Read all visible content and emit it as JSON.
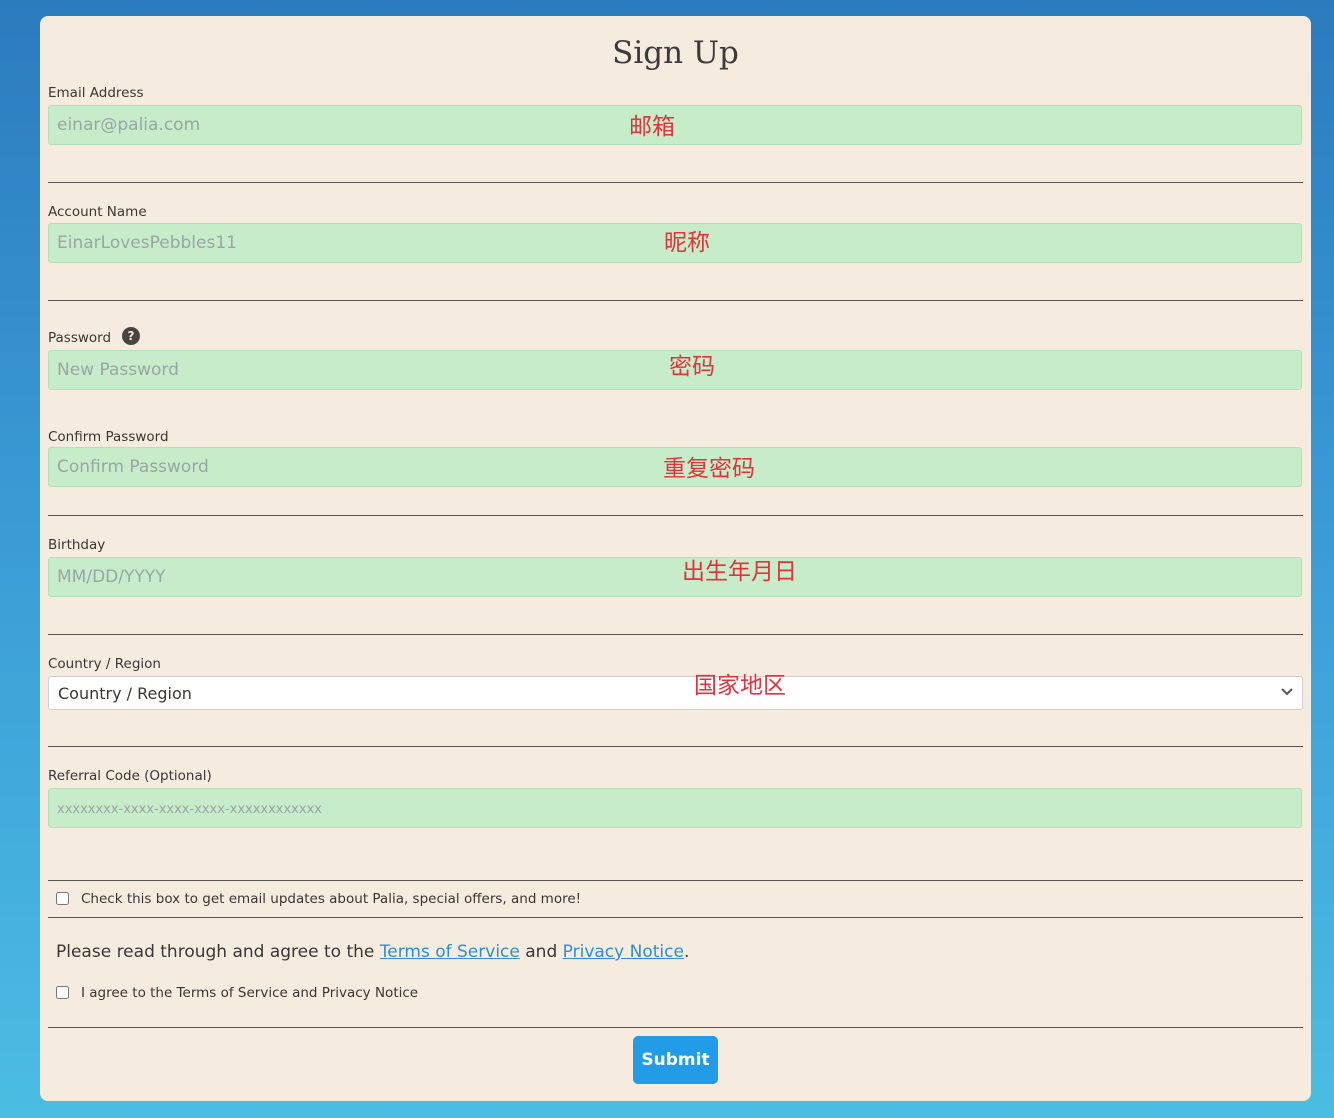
{
  "title": "Sign Up",
  "email": {
    "label": "Email Address",
    "placeholder": "einar@palia.com",
    "annotation": "邮箱"
  },
  "account": {
    "label": "Account Name",
    "placeholder": "EinarLovesPebbles11",
    "annotation": "昵称"
  },
  "password": {
    "label": "Password",
    "help_icon": "?",
    "placeholder": "New Password",
    "annotation": "密码"
  },
  "confirm": {
    "label": "Confirm Password",
    "placeholder": "Confirm Password",
    "annotation": "重复密码"
  },
  "birthday": {
    "label": "Birthday",
    "placeholder": "MM/DD/YYYY",
    "annotation": "出生年月日"
  },
  "country": {
    "label": "Country / Region",
    "selected": "Country / Region",
    "annotation": "国家地区"
  },
  "referral": {
    "label": "Referral Code (Optional)",
    "placeholder": "xxxxxxxx-xxxx-xxxx-xxxx-xxxxxxxxxxxx"
  },
  "updates_checkbox": {
    "label": "Check this box to get email updates about Palia, special offers, and more!"
  },
  "agreement": {
    "prefix": "Please read through and agree to the ",
    "terms_link": "Terms of Service",
    "middle": " and ",
    "privacy_link": "Privacy Notice",
    "suffix": ".",
    "checkbox_label": "I agree to the Terms of Service and Privacy Notice"
  },
  "submit_label": "Submit",
  "colors": {
    "background_top": "#2b7bbd",
    "background_bottom": "#4bbde3",
    "card": "#f6ebdf",
    "input_fill": "#c6ecca",
    "annotation": "#e5313a",
    "link": "#2a8fd8",
    "submit": "#229ce6"
  }
}
